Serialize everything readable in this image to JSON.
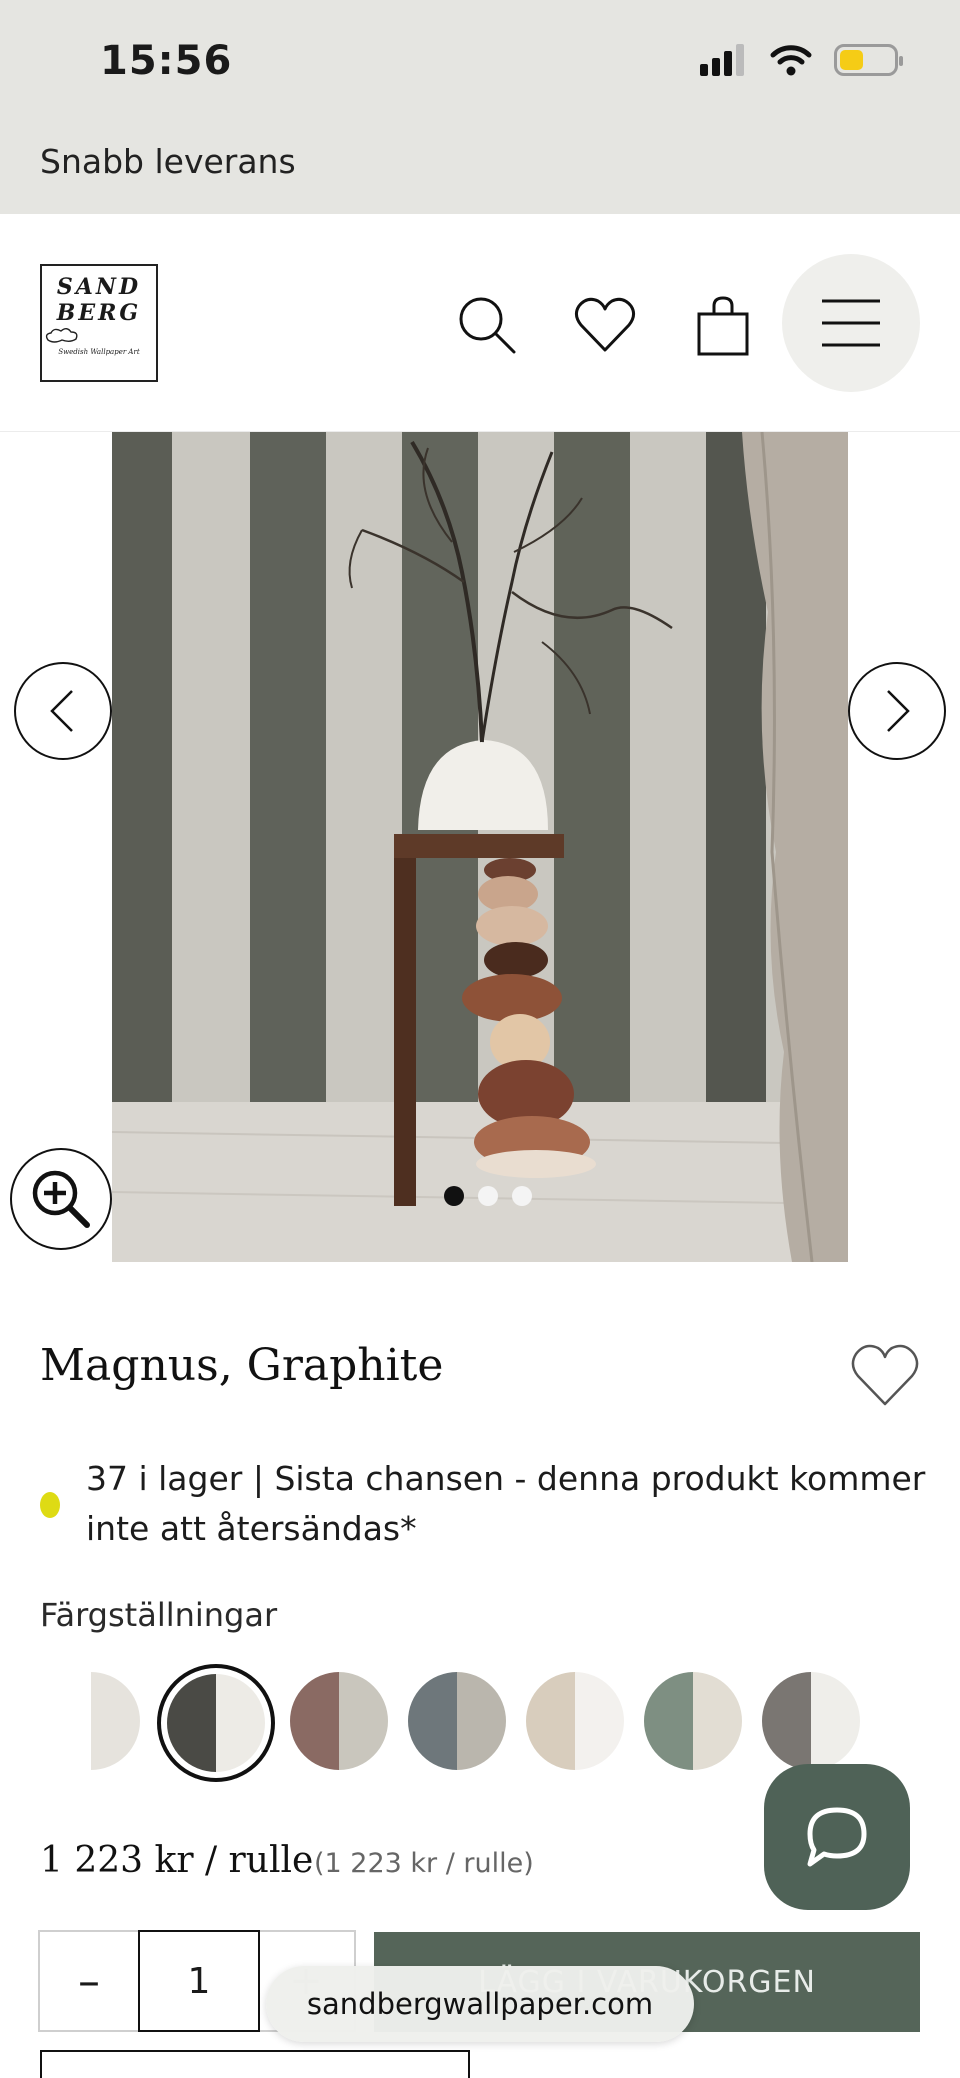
{
  "status_bar": {
    "time": "15:56"
  },
  "promo_strip": {
    "text": "Snabb leverans"
  },
  "header": {
    "logo": {
      "line1": "SAND",
      "line2": "BERG",
      "tagline": "Swedish Wallpaper Art"
    },
    "icons": [
      "search-icon",
      "heart-icon",
      "bag-icon",
      "menu-icon"
    ]
  },
  "gallery": {
    "slide_count": 3,
    "active_index": 0
  },
  "product": {
    "title": "Magnus, Graphite",
    "stock_text": "37 i lager | Sista chansen - denna produkt kommer inte att återsändas*",
    "stock_color": "#dedb14",
    "colors_label": "Färgställningar",
    "swatches": [
      {
        "left": "#ffffff",
        "right": "#e6e3dd"
      },
      {
        "left": "#4a4a45",
        "right": "#edebe6"
      },
      {
        "left": "#8a6a63",
        "right": "#c9c6bd"
      },
      {
        "left": "#6e777b",
        "right": "#bab6ad"
      },
      {
        "left": "#d8cdbd",
        "right": "#f3f1ee"
      },
      {
        "left": "#7e8f82",
        "right": "#e2ddd3"
      },
      {
        "left": "#7a7672",
        "right": "#efeeea"
      }
    ],
    "selected_swatch": 1,
    "price": "1 223 kr / rulle",
    "price_note": "(1 223 kr / rulle)"
  },
  "purchase": {
    "quantity": "1",
    "minus": "–",
    "plus": "+",
    "cart_label": "LÄGG I VARUKORGEN"
  },
  "browser": {
    "url": "sandbergwallpaper.com"
  },
  "accent_color": "#556559"
}
